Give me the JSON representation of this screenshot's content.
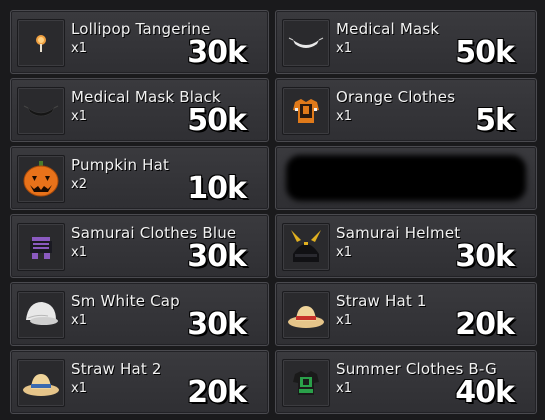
{
  "items": [
    {
      "name": "Lollipop Tangerine",
      "qty": "x1",
      "price": "30k",
      "icon": "lollipop-icon"
    },
    {
      "name": "Medical Mask",
      "qty": "x1",
      "price": "50k",
      "icon": "medical-mask-icon"
    },
    {
      "name": "Medical Mask Black",
      "qty": "x1",
      "price": "50k",
      "icon": "medical-mask-black-icon"
    },
    {
      "name": "Orange Clothes",
      "qty": "x1",
      "price": "5k",
      "icon": "orange-clothes-icon"
    },
    {
      "name": "Pumpkin Hat",
      "qty": "x2",
      "price": "10k",
      "icon": "pumpkin-hat-icon"
    },
    {
      "name": "Samurai Clothes Blue",
      "qty": "x1",
      "price": "30k",
      "icon": "samurai-clothes-icon"
    },
    {
      "name": "Samurai Helmet",
      "qty": "x1",
      "price": "30k",
      "icon": "samurai-helmet-icon"
    },
    {
      "name": "Sm White Cap",
      "qty": "x1",
      "price": "30k",
      "icon": "white-cap-icon"
    },
    {
      "name": "Straw Hat 1",
      "qty": "x1",
      "price": "20k",
      "icon": "straw-hat-icon"
    },
    {
      "name": "Straw Hat 2",
      "qty": "x1",
      "price": "20k",
      "icon": "straw-hat-2-icon"
    },
    {
      "name": "Summer Clothes B-G",
      "qty": "x1",
      "price": "40k",
      "icon": "summer-clothes-icon"
    }
  ]
}
